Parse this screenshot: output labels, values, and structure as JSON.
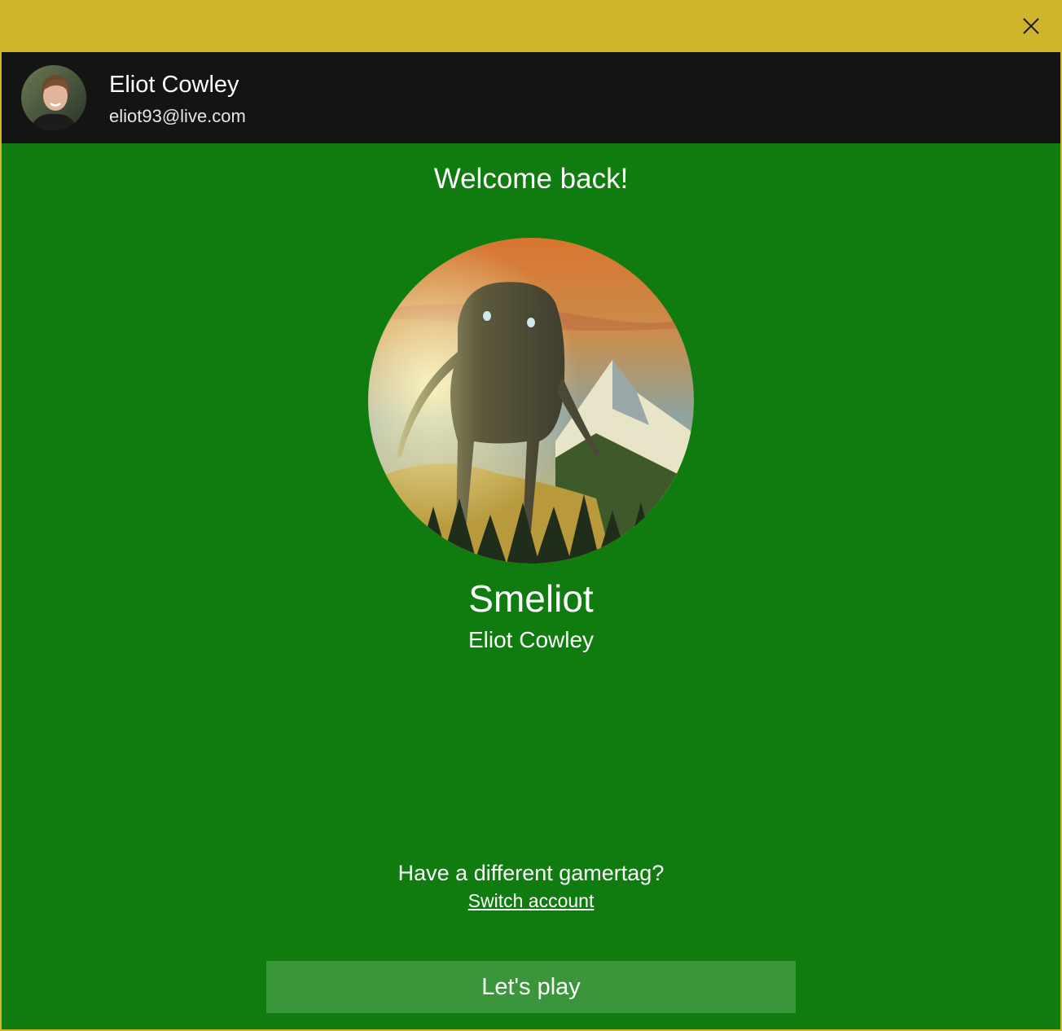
{
  "titlebar": {
    "close_icon": "close-icon"
  },
  "account": {
    "name": "Eliot Cowley",
    "email": "eliot93@live.com",
    "avatar_icon": "user-avatar"
  },
  "main": {
    "welcome": "Welcome back!",
    "gamertag": "Smeliot",
    "real_name": "Eliot Cowley",
    "gamerpic_icon": "gamerpic-creature-mountains"
  },
  "footer": {
    "different_prompt": "Have a different gamertag?",
    "switch_link": "Switch account",
    "play_label": "Let's play"
  },
  "colors": {
    "titlebar": "#cfb52b",
    "account_bar": "#141414",
    "background": "#107c10",
    "button": "#3b953b"
  }
}
